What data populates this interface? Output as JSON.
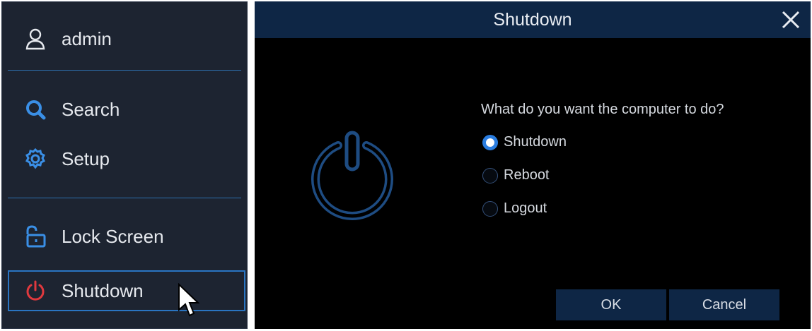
{
  "menu": {
    "user": "admin",
    "items": [
      {
        "label": "Search",
        "icon": "search-icon"
      },
      {
        "label": "Setup",
        "icon": "gear-icon"
      },
      {
        "label": "Lock Screen",
        "icon": "lock-open-icon"
      },
      {
        "label": "Shutdown",
        "icon": "power-icon"
      }
    ],
    "active_item": "Shutdown"
  },
  "dialog": {
    "title": "Shutdown",
    "prompt": "What do you want the computer to do?",
    "options": [
      {
        "label": "Shutdown",
        "checked": true
      },
      {
        "label": "Reboot",
        "checked": false
      },
      {
        "label": "Logout",
        "checked": false
      }
    ],
    "ok_label": "OK",
    "cancel_label": "Cancel"
  },
  "colors": {
    "accent": "#2a7de0",
    "menu_bg": "#1d2431",
    "header_bg": "#0e2645",
    "shutdown_red": "#e0393e"
  }
}
